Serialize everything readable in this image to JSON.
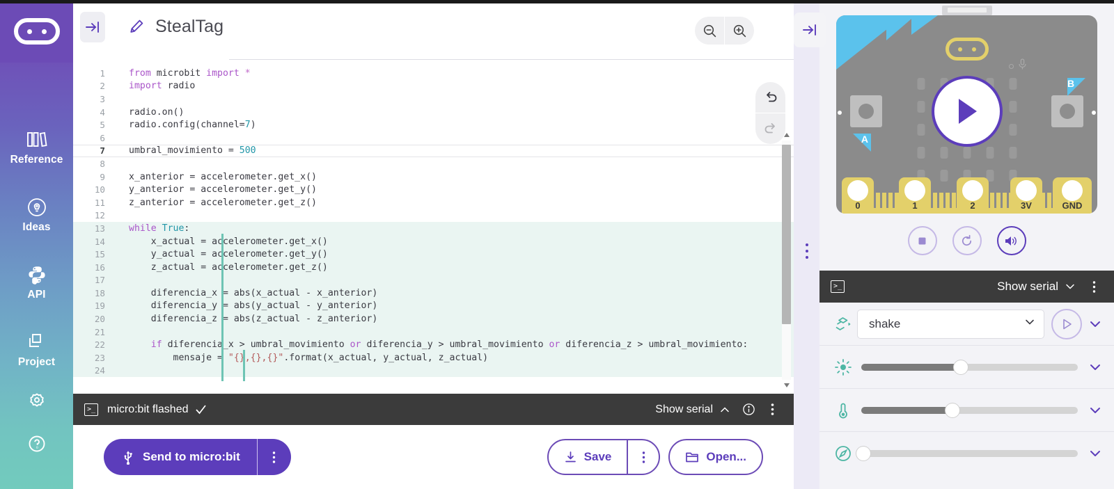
{
  "sidebar": {
    "logo_name": "microbit-logo",
    "items": [
      {
        "label": "Reference",
        "icon": "book-icon"
      },
      {
        "label": "Ideas",
        "icon": "lightbulb-icon"
      },
      {
        "label": "API",
        "icon": "python-icon"
      },
      {
        "label": "Project",
        "icon": "files-icon"
      }
    ],
    "bottom_items": [
      {
        "name": "settings-gear-icon"
      },
      {
        "name": "help-question-icon"
      }
    ]
  },
  "editor": {
    "collapse_icon": "collapse-panel-icon",
    "pencil_icon": "pencil-edit-icon",
    "project_title": "StealTag",
    "zoom_out_label": "zoom-out",
    "zoom_in_label": "zoom-in",
    "undo_label": "undo",
    "redo_label": "redo",
    "lines": [
      {
        "n": "1",
        "html": "<span class='kw'>from</span> microbit <span class='kw'>import</span> <span class='op'>*</span>"
      },
      {
        "n": "2",
        "html": "<span class='kw'>import</span> radio"
      },
      {
        "n": "3",
        "html": ""
      },
      {
        "n": "4",
        "html": "radio.on()"
      },
      {
        "n": "5",
        "html": "radio.config(channel=<span class='num'>7</span>)"
      },
      {
        "n": "6",
        "html": ""
      },
      {
        "n": "7",
        "html": "umbral_movimiento = <span class='num'>500</span>",
        "current": true
      },
      {
        "n": "8",
        "html": ""
      },
      {
        "n": "9",
        "html": "x_anterior = accelerometer.get_x()"
      },
      {
        "n": "10",
        "html": "y_anterior = accelerometer.get_y()"
      },
      {
        "n": "11",
        "html": "z_anterior = accelerometer.get_z()"
      },
      {
        "n": "12",
        "html": ""
      },
      {
        "n": "13",
        "html": "<span class='kw'>while</span> <span class='num'>True</span>:",
        "hl": true
      },
      {
        "n": "14",
        "html": "    x_actual = accelerometer.get_x()",
        "hl": true
      },
      {
        "n": "15",
        "html": "    y_actual = accelerometer.get_y()",
        "hl": true
      },
      {
        "n": "16",
        "html": "    z_actual = accelerometer.get_z()",
        "hl": true
      },
      {
        "n": "17",
        "html": "",
        "hl": true
      },
      {
        "n": "18",
        "html": "    diferencia_x = abs(x_actual - x_anterior)",
        "hl": true
      },
      {
        "n": "19",
        "html": "    diferencia_y = abs(y_actual - y_anterior)",
        "hl": true
      },
      {
        "n": "20",
        "html": "    diferencia_z = abs(z_actual - z_anterior)",
        "hl": true
      },
      {
        "n": "21",
        "html": "",
        "hl": true
      },
      {
        "n": "22",
        "html": "    <span class='kw'>if</span> diferencia_x &gt; umbral_movimiento <span class='kw'>or</span> diferencia_y &gt; umbral_movimiento <span class='kw'>or</span> diferencia_z &gt; umbral_movimiento:",
        "hl": true
      },
      {
        "n": "23",
        "html": "        mensaje = <span class='str'>\"{},{},{}\"</span>.format(x_actual, y_actual, z_actual)",
        "hl": true
      },
      {
        "n": "24",
        "html": "",
        "hl": true
      }
    ]
  },
  "statusbar": {
    "terminal_icon": "terminal-icon",
    "status_text": "micro:bit flashed",
    "check_icon": "checkmark-icon",
    "show_serial_label": "Show serial",
    "chevron": "chevron-up-icon",
    "info_icon": "info-icon",
    "more_icon": "kebab-menu-icon"
  },
  "actions": {
    "send_label": "Send to micro:bit",
    "send_icon": "usb-icon",
    "send_more_icon": "kebab-menu-icon",
    "save_label": "Save",
    "save_icon": "download-icon",
    "save_more_icon": "kebab-menu-icon",
    "open_label": "Open...",
    "open_icon": "folder-icon"
  },
  "simulator": {
    "expand_icon": "expand-panel-icon",
    "drag_handle": "drag-handle",
    "board": {
      "play_icon": "play-icon",
      "button_a_label": "A",
      "button_b_label": "B",
      "pins": [
        "0",
        "1",
        "2",
        "3V",
        "GND"
      ],
      "chip_name": "microbit-logo-chip",
      "mic_icon": "microphone-icon"
    },
    "controls": [
      {
        "name": "stop-button",
        "icon": "stop-icon",
        "active": false
      },
      {
        "name": "reset-button",
        "icon": "reset-icon",
        "active": false
      },
      {
        "name": "mute-button",
        "icon": "speaker-icon",
        "active": true
      }
    ],
    "serial": {
      "terminal_icon": "terminal-icon",
      "show_serial_label": "Show serial",
      "chevron": "chevron-down-icon",
      "more_icon": "kebab-menu-icon"
    },
    "sensors": [
      {
        "name": "gesture",
        "icon": "gesture-icon",
        "type": "select",
        "value": "shake",
        "has_play": true
      },
      {
        "name": "light-level",
        "icon": "sun-icon",
        "type": "slider",
        "percent": 46
      },
      {
        "name": "temperature",
        "icon": "thermometer-icon",
        "type": "slider",
        "percent": 42
      },
      {
        "name": "compass",
        "icon": "compass-icon",
        "type": "slider",
        "percent": 1
      }
    ]
  },
  "colors": {
    "brand_purple": "#5c3dbb",
    "sidebar_top": "#6c4bb6",
    "sidebar_bottom": "#72cbbd",
    "accent_teal": "#6ec4b4",
    "status_dark": "#3b3b3b",
    "board_grey": "#8b8b8b",
    "board_blue": "#5bc2ec",
    "board_yellow": "#e3d06a"
  }
}
